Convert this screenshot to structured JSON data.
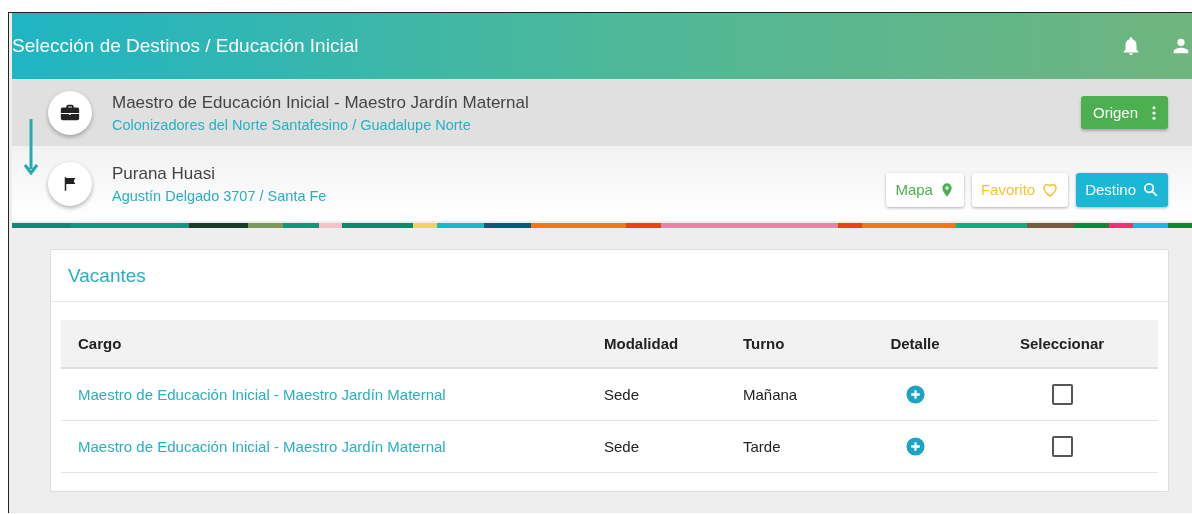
{
  "header": {
    "title": "Selección de Destinos / Educación Inicial"
  },
  "origin": {
    "title": "Maestro de Educación Inicial - Maestro Jardín Maternal",
    "subtitle": "Colonizadores del Norte Santafesino / Guadalupe Norte",
    "button": "Origen"
  },
  "destination": {
    "title": "Purana Huasi",
    "subtitle": "Agustín Delgado 3707 / Santa Fe",
    "buttons": [
      {
        "kind": "map",
        "label": "Mapa"
      },
      {
        "kind": "favorite",
        "label": "Favorito"
      },
      {
        "kind": "search",
        "label": "Destino"
      }
    ]
  },
  "vacancies": {
    "title": "Vacantes",
    "columns": [
      "Cargo",
      "Modalidad",
      "Turno",
      "Detalle",
      "Seleccionar"
    ],
    "rows": [
      {
        "cargo": "Maestro de Educación Inicial - Maestro Jardín Maternal",
        "modalidad": "Sede",
        "turno": "Mañana",
        "checked": false
      },
      {
        "cargo": "Maestro de Educación Inicial - Maestro Jardín Maternal",
        "modalidad": "Sede",
        "turno": "Tarde",
        "checked": false
      }
    ]
  }
}
